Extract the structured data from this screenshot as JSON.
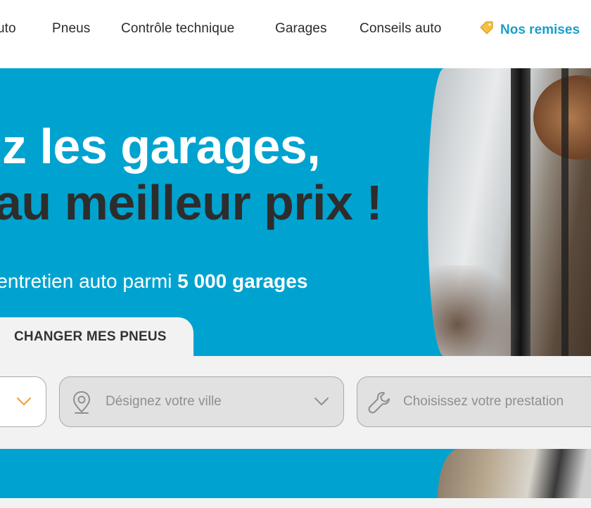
{
  "nav": {
    "items": [
      "uto",
      "Pneus",
      "Contrôle technique",
      "Garages",
      "Conseils auto"
    ],
    "remises": "Nos remises",
    "accent": "#1b9ec9"
  },
  "hero": {
    "title_line1": "z les garages,",
    "title_line2": "au meilleur prix !",
    "subtitle_prefix": "'entretien auto parmi ",
    "subtitle_bold": "5 000 garages",
    "background": "#00a3cf"
  },
  "tabs": {
    "active_label": "CHANGER MES PNEUS"
  },
  "search": {
    "city_placeholder": "Désignez votre ville",
    "service_placeholder": "Choisissez votre prestation",
    "icons": [
      "chevron-down-icon",
      "location-pin-icon",
      "wrench-icon"
    ]
  }
}
